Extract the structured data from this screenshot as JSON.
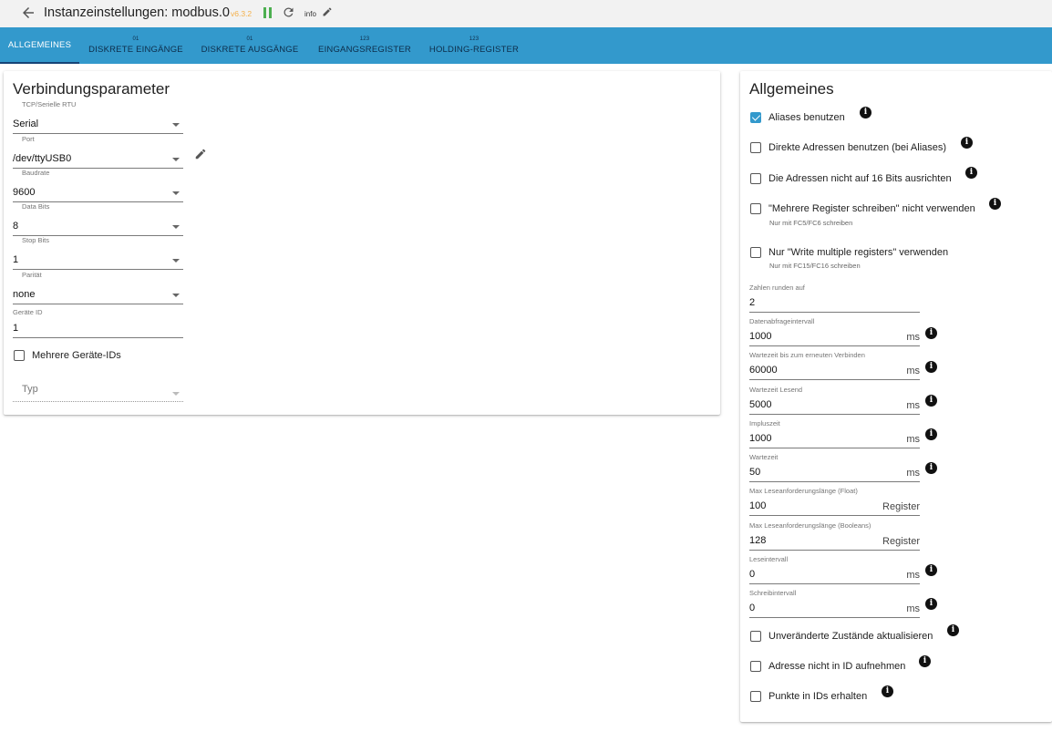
{
  "header": {
    "title": "Instanzeinstellungen: modbus.0",
    "version": "v6.3.2",
    "info_label": "info",
    "colors": {
      "version": "#f4b04a",
      "pause": "#4caf50"
    }
  },
  "tabs": [
    {
      "badge": "",
      "label": "ALLGEMEINES"
    },
    {
      "badge": "01",
      "label": "DISKRETE EINGÄNGE"
    },
    {
      "badge": "01",
      "label": "DISKRETE AUSGÄNGE"
    },
    {
      "badge": "123",
      "label": "EINGANGSREGISTER"
    },
    {
      "badge": "123",
      "label": "HOLDING-REGISTER"
    }
  ],
  "left": {
    "title": "Verbindungsparameter",
    "type": {
      "label": "TCP/Serielle RTU",
      "value": "Serial"
    },
    "port": {
      "label": "Port",
      "value": "/dev/ttyUSB0"
    },
    "baud": {
      "label": "Baudrate",
      "value": "9600"
    },
    "databits": {
      "label": "Data Bits",
      "value": "8"
    },
    "stopbits": {
      "label": "Stop Bits",
      "value": "1"
    },
    "parity": {
      "label": "Parität",
      "value": "none"
    },
    "deviceid": {
      "label": "Geräte ID",
      "value": "1"
    },
    "multi": {
      "label": "Mehrere Geräte-IDs",
      "checked": false
    },
    "typ": {
      "placeholder": "Typ"
    }
  },
  "right": {
    "title": "Allgemeines",
    "checks": [
      {
        "label": "Aliases benutzen",
        "checked": true,
        "sub": ""
      },
      {
        "label": "Direkte Adressen benutzen (bei Aliases)",
        "checked": false,
        "sub": ""
      },
      {
        "label": "Die Adressen nicht auf 16 Bits ausrichten",
        "checked": false,
        "sub": ""
      },
      {
        "label": "\"Mehrere Register schreiben\" nicht verwenden",
        "checked": false,
        "sub": "Nur mit FC5/FC6 schreiben"
      },
      {
        "label": "Nur \"Write multiple registers\" verwenden",
        "checked": false,
        "sub": "Nur mit FC15/FC16 schreiben"
      }
    ],
    "fields": [
      {
        "label": "Zahlen runden auf",
        "value": "2",
        "unit": ""
      },
      {
        "label": "Datenabfrageintervall",
        "value": "1000",
        "unit": "ms"
      },
      {
        "label": "Wartezeit bis zum erneuten Verbinden",
        "value": "60000",
        "unit": "ms"
      },
      {
        "label": "Wartezeit Lesend",
        "value": "5000",
        "unit": "ms"
      },
      {
        "label": "Impluszeit",
        "value": "1000",
        "unit": "ms"
      },
      {
        "label": "Wartezeit",
        "value": "50",
        "unit": "ms"
      },
      {
        "label": "Max Leseanforderungslänge (Float)",
        "value": "100",
        "unit": "Register"
      },
      {
        "label": "Max Leseanforderungslänge (Booleans)",
        "value": "128",
        "unit": "Register"
      },
      {
        "label": "Leseintervall",
        "value": "0",
        "unit": "ms"
      },
      {
        "label": "Schreibintervall",
        "value": "0",
        "unit": "ms"
      }
    ],
    "bottom_checks": [
      {
        "label": "Unveränderte Zustände aktualisieren",
        "checked": false
      },
      {
        "label": "Adresse nicht in ID aufnehmen",
        "checked": false
      },
      {
        "label": "Punkte in IDs erhalten",
        "checked": false
      }
    ]
  }
}
